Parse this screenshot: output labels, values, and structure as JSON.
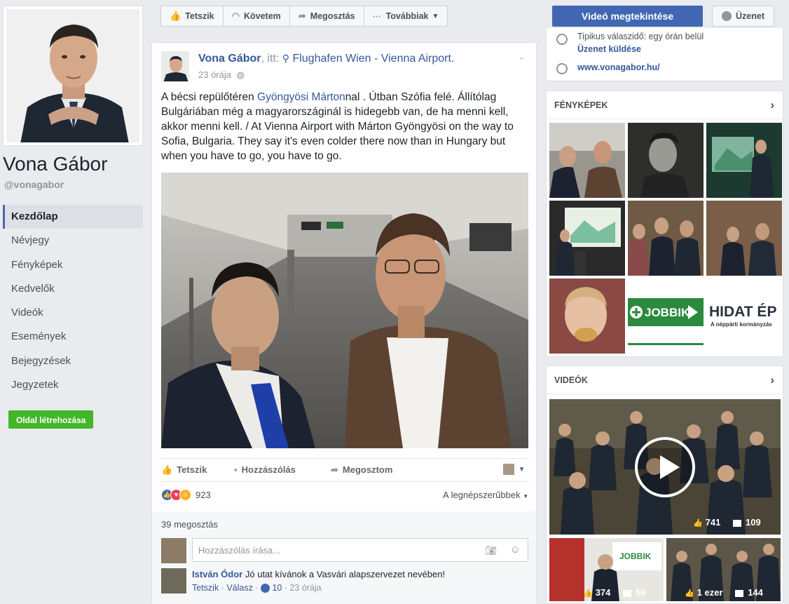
{
  "page": {
    "name": "Vona Gábor",
    "handle": "@vonagabor"
  },
  "left_nav": {
    "items": [
      {
        "label": "Kezdőlap",
        "active": true
      },
      {
        "label": "Névjegy"
      },
      {
        "label": "Fényképek"
      },
      {
        "label": "Kedvelők"
      },
      {
        "label": "Videók"
      },
      {
        "label": "Események"
      },
      {
        "label": "Bejegyzések"
      },
      {
        "label": "Jegyzetek"
      }
    ],
    "create_page": "Oldal létrehozása"
  },
  "action_bar": {
    "like": "Tetszik",
    "follow": "Követem",
    "share": "Megosztás",
    "more": "Továbbiak",
    "video": "Videó megtekintése",
    "message": "Üzenet"
  },
  "post": {
    "author": "Vona Gábor",
    "at": ", itt:",
    "location": "Flughafen Wien - Vienna Airport.",
    "time": "23 órája",
    "text_pre": "A bécsi repülőtéren ",
    "mention": "Gyöngyösi Márton",
    "text_post": "nal . Útban Szófia felé. Állítólag Bulgáriában még a magyarországinál is hidegebb van, de ha menni kell, akkor menni kell. / At Vienna Airport with Márton Gyöngyösi on the way to Sofia, Bulgaria. They say it's even colder there now than in Hungary but when you have to go, you have to go.",
    "actions": {
      "like": "Tetszik",
      "comment": "Hozzászólás",
      "share": "Megosztom"
    },
    "reaction_count": "923",
    "sort": "A legnépszerűbbek",
    "shares": "39 megosztás",
    "comment_placeholder": "Hozzászólás írása...",
    "comment": {
      "author": "István Ódor",
      "text": "Jó utat kívánok a Vasvári alapszervezet nevében!",
      "like": "Tetszik",
      "reply": "Válasz",
      "likes": "10",
      "time": "23 órája"
    }
  },
  "info": {
    "response": "Tipikus válaszidő: egy órán belül",
    "send_message": "Üzenet küldése",
    "website": "www.vonagabor.hu/"
  },
  "photos": {
    "title": "FÉNYKÉPEK",
    "jobbik_text": "JOBBIK",
    "hidat_text": "HIDAT ÉP",
    "hidat_sub": "A néppárti kormányzás"
  },
  "videos": {
    "title": "VIDEÓK",
    "main_likes": "741",
    "main_comments": "109",
    "left_likes": "374",
    "left_comments": "56",
    "right_likes": "1 ezer",
    "right_comments": "144",
    "jobbik_text": "JOBBIK"
  }
}
